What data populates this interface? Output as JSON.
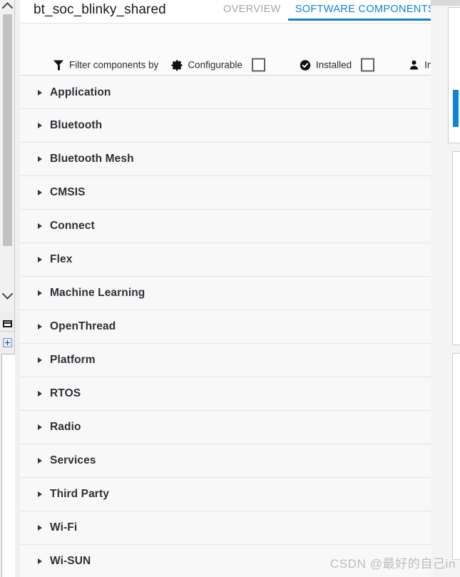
{
  "window": {
    "title": "bt_soc_blinky_shared"
  },
  "tabs": [
    {
      "label": "OVERVIEW",
      "active": false
    },
    {
      "label": "SOFTWARE COMPONENTS",
      "active": true
    }
  ],
  "filter_bar": {
    "funnel_icon": "filter-icon",
    "filter_label": "Filter components by",
    "configurable": {
      "icon": "gear-icon",
      "label": "Configurable",
      "checked": false
    },
    "installed": {
      "icon": "check-circle-icon",
      "label": "Installed",
      "checked": false
    },
    "installed_by": {
      "icon": "person-icon",
      "label": "Installed by"
    }
  },
  "component_list": {
    "rows": [
      {
        "label": "Application",
        "expanded": false
      },
      {
        "label": "Bluetooth",
        "expanded": false
      },
      {
        "label": "Bluetooth Mesh",
        "expanded": false
      },
      {
        "label": "CMSIS",
        "expanded": false
      },
      {
        "label": "Connect",
        "expanded": false
      },
      {
        "label": "Flex",
        "expanded": false
      },
      {
        "label": "Machine Learning",
        "expanded": false
      },
      {
        "label": "OpenThread",
        "expanded": false
      },
      {
        "label": "Platform",
        "expanded": false
      },
      {
        "label": "RTOS",
        "expanded": false
      },
      {
        "label": "Radio",
        "expanded": false
      },
      {
        "label": "Services",
        "expanded": false
      },
      {
        "label": "Third Party",
        "expanded": false
      },
      {
        "label": "Wi-Fi",
        "expanded": false
      },
      {
        "label": "Wi-SUN",
        "expanded": false
      }
    ]
  },
  "colors": {
    "accent_blue": "#0f82d6",
    "panel_accent_blue": "#1183d4",
    "row_background": "#f8f8f8",
    "row_text": "#2c3137",
    "inactive_tab": "#a6a6a6"
  },
  "watermark": {
    "text": "CSDN @最好的自己in"
  }
}
